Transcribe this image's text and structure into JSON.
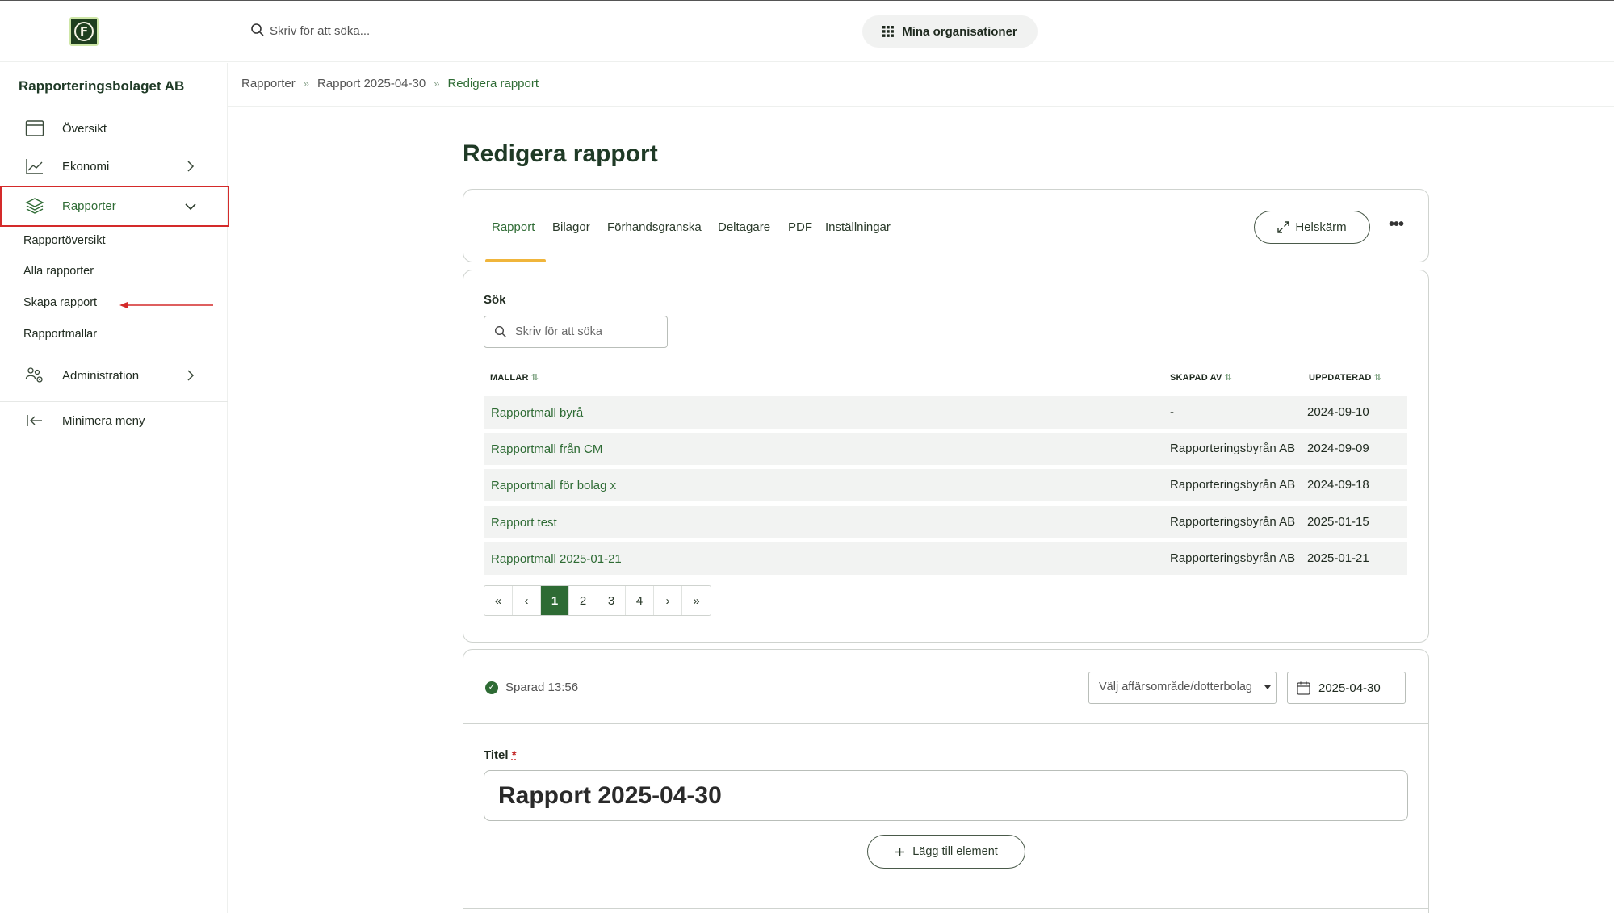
{
  "topbar": {
    "logo_letter": "F",
    "search_placeholder": "Skriv för att söka...",
    "org_button": "Mina organisationer"
  },
  "sidebar": {
    "org_name": "Rapporteringsbolaget AB",
    "items": [
      {
        "label": "Översikt",
        "icon": "calendar-icon"
      },
      {
        "label": "Ekonomi",
        "icon": "chart-line-icon"
      },
      {
        "label": "Rapporter",
        "icon": "layers-icon"
      },
      {
        "label": "Administration",
        "icon": "users-gear-icon"
      }
    ],
    "sub_items": [
      "Rapportöversikt",
      "Alla rapporter",
      "Skapa rapport",
      "Rapportmallar"
    ],
    "minimize": "Minimera meny"
  },
  "breadcrumb": [
    "Rapporter",
    "Rapport 2025-04-30",
    "Redigera rapport"
  ],
  "page_title": "Redigera rapport",
  "tabs": [
    "Rapport",
    "Bilagor",
    "Förhandsgranska",
    "Deltagare",
    "PDF",
    "Inställningar"
  ],
  "fullscreen_label": "Helskärm",
  "more_label": "•••",
  "templates": {
    "search_label": "Sök",
    "search_placeholder": "Skriv för att söka",
    "columns": {
      "name": "MALLAR",
      "created_by": "SKAPAD AV",
      "updated": "UPPDATERAD"
    },
    "sort_icon": "⇅",
    "rows": [
      {
        "name": "Rapportmall byrå",
        "created_by": "-",
        "updated": "2024-09-10"
      },
      {
        "name": "Rapportmall från CM",
        "created_by": "Rapporteringsbyrån AB",
        "updated": "2024-09-09"
      },
      {
        "name": "Rapportmall för bolag x",
        "created_by": "Rapporteringsbyrån AB",
        "updated": "2024-09-18"
      },
      {
        "name": "Rapport test",
        "created_by": "Rapporteringsbyrån AB",
        "updated": "2025-01-15"
      },
      {
        "name": "Rapportmall 2025-01-21",
        "created_by": "Rapporteringsbyrån AB",
        "updated": "2025-01-21"
      }
    ],
    "pager": {
      "first": "«",
      "prev": "‹",
      "pages": [
        "1",
        "2",
        "3",
        "4"
      ],
      "next": "›",
      "last": "»",
      "current": "1"
    }
  },
  "editor": {
    "saved_text": "Sparad 13:56",
    "select_placeholder": "Välj affärsområde/dotterbolag",
    "date": "2025-04-30",
    "title_label": "Titel",
    "required_mark": "*",
    "title_value": "Rapport 2025-04-30",
    "add_element": "Lägg till element"
  },
  "colors": {
    "brand_green": "#2e6b34",
    "tab_underline": "#f0b53b",
    "highlight_red": "#d42a2a"
  }
}
